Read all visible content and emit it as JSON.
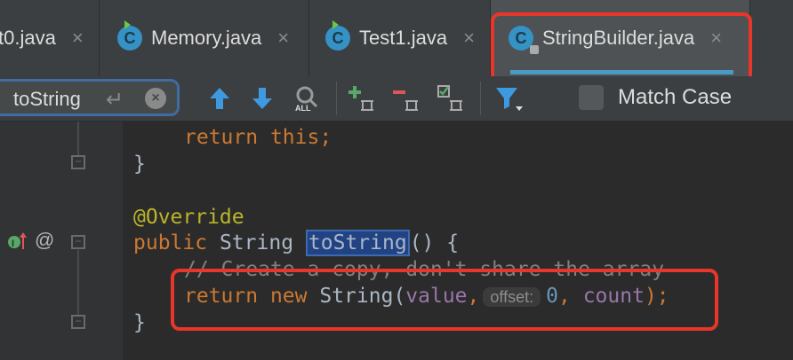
{
  "tabs": [
    {
      "label": "t0.java",
      "close": "×"
    },
    {
      "label": "Memory.java",
      "close": "×",
      "icon": "class-run-icon",
      "icon_letter": "C"
    },
    {
      "label": "Test1.java",
      "close": "×",
      "icon": "class-run-icon",
      "icon_letter": "C"
    },
    {
      "label": "StringBuilder.java",
      "close": "×",
      "icon": "class-locked-icon",
      "icon_letter": "C",
      "active": true
    }
  ],
  "search": {
    "query": "toString",
    "return_glyph": "↵",
    "clear_glyph": "×",
    "match_case_label": "Match Case",
    "all_label": "ALL"
  },
  "code": {
    "l1_kw": "return",
    "l1_kw2": "this",
    "l1_punct": ";",
    "l2": "}",
    "l3": "@Override",
    "l4_kw": "public",
    "l4_type": "String",
    "l4_name": "toString",
    "l4_rest": "() {",
    "l5": "// Create a copy, don't share the array",
    "l6_kw1": "return",
    "l6_kw2": "new",
    "l6_type": "String(",
    "l6_arg1": "value",
    "l6_hint": "offset:",
    "l6_num": "0",
    "l6_arg2": "count",
    "l6_end": ");",
    "l7": "}"
  },
  "gutter": {
    "at_sign": "@"
  },
  "colors": {
    "highlight_box": "#e8362a",
    "keyword": "#cc7832",
    "annotation": "#bbb529",
    "field": "#9876aa"
  }
}
